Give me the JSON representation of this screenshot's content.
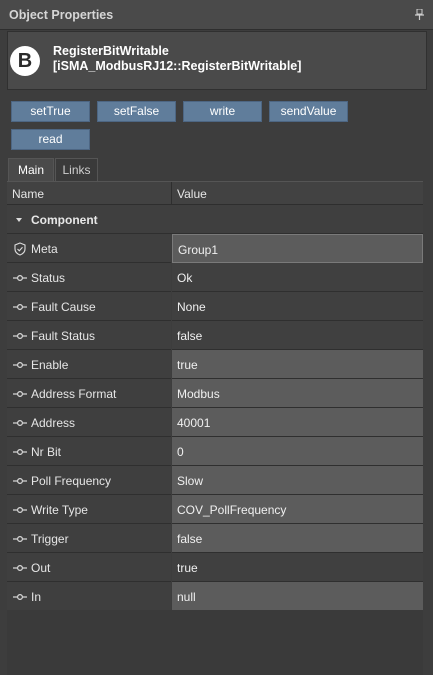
{
  "panel": {
    "title": "Object Properties"
  },
  "object": {
    "icon_letter": "B",
    "name": "RegisterBitWritable",
    "type": "[iSMA_ModbusRJ12::RegisterBitWritable]"
  },
  "actions": {
    "set_true": "setTrue",
    "set_false": "setFalse",
    "write": "write",
    "send_value": "sendValue",
    "read": "read"
  },
  "tabs": {
    "main": "Main",
    "links": "Links"
  },
  "table": {
    "col_name": "Name",
    "col_value": "Value",
    "group": "Component",
    "rows": [
      {
        "name": "Meta",
        "value": "Group1"
      },
      {
        "name": "Status",
        "value": "Ok"
      },
      {
        "name": "Fault Cause",
        "value": "None"
      },
      {
        "name": "Fault Status",
        "value": "false"
      },
      {
        "name": "Enable",
        "value": "true"
      },
      {
        "name": "Address Format",
        "value": "Modbus"
      },
      {
        "name": "Address",
        "value": "40001"
      },
      {
        "name": "Nr Bit",
        "value": "0"
      },
      {
        "name": "Poll Frequency",
        "value": "Slow"
      },
      {
        "name": "Write Type",
        "value": "COV_PollFrequency"
      },
      {
        "name": "Trigger",
        "value": "false"
      },
      {
        "name": "Out",
        "value": "true"
      },
      {
        "name": "In",
        "value": "null"
      }
    ]
  },
  "colors": {
    "button": "#607d9b",
    "panel_bg": "#3d3d3d",
    "editable_cell": "#5c5c5c"
  }
}
